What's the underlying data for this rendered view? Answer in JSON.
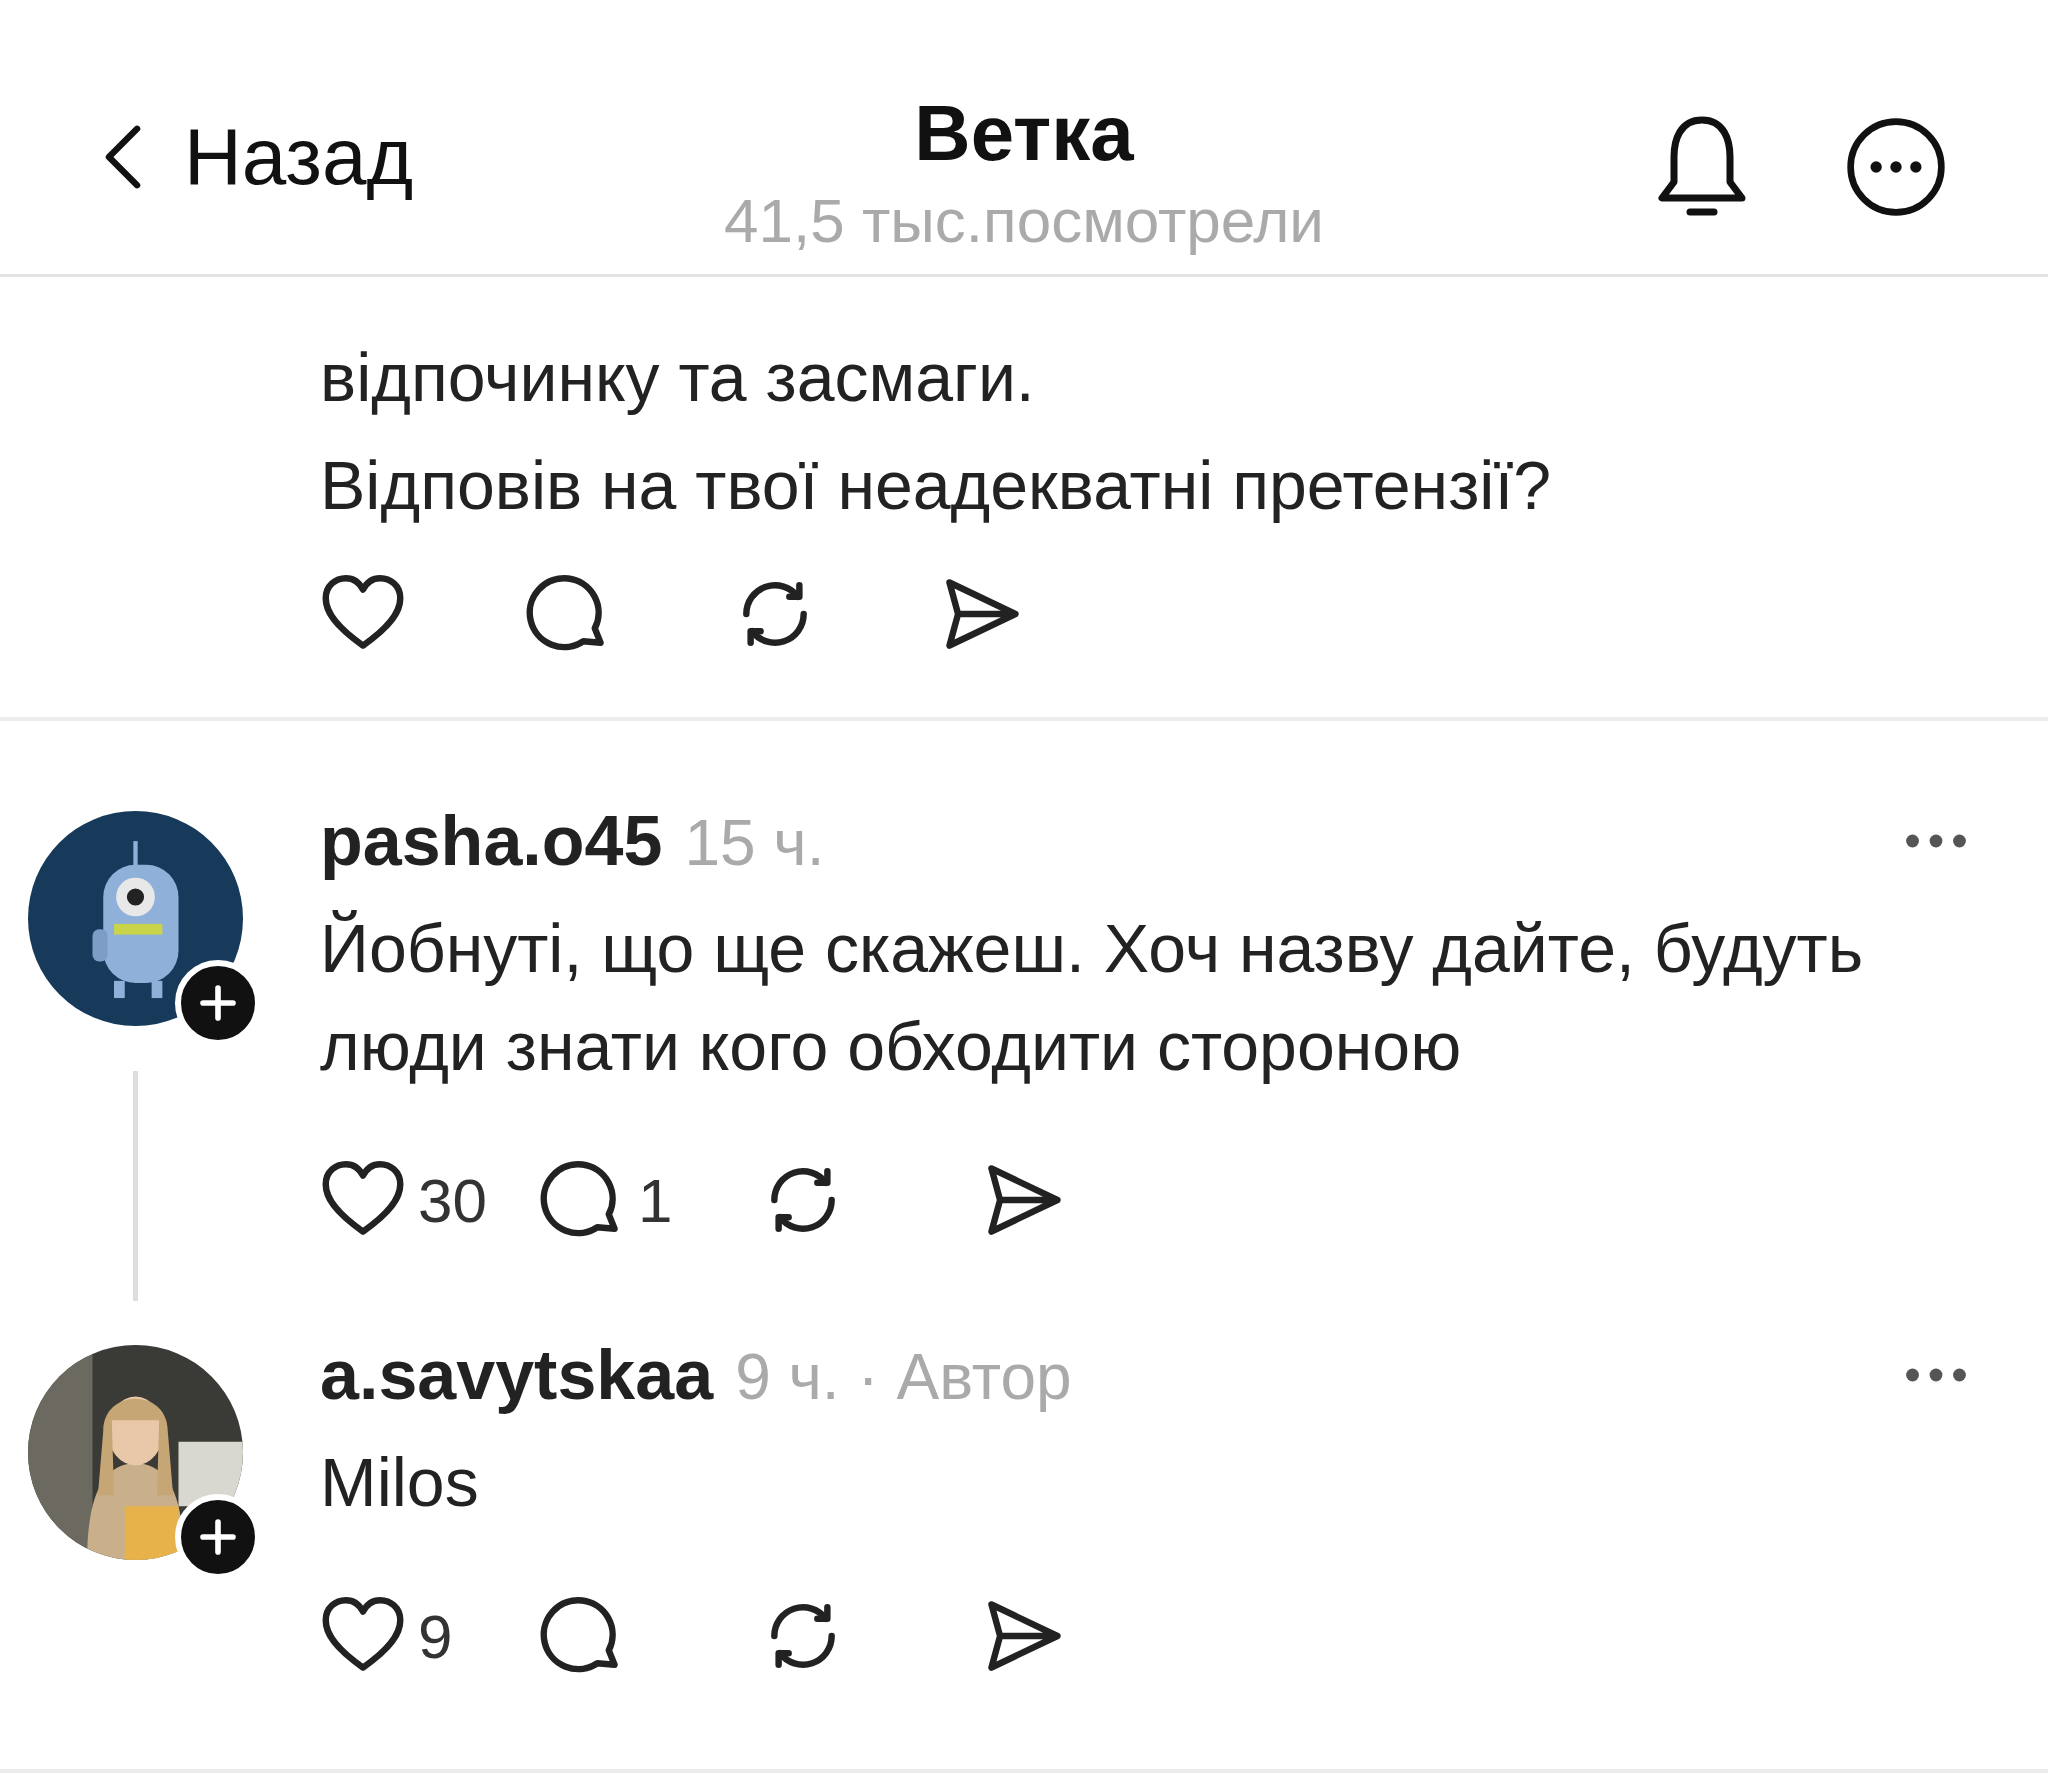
{
  "header": {
    "back_label": "Назад",
    "title": "Ветка",
    "subtitle": "41,5 тыс.посмотрели"
  },
  "parent_post": {
    "text_lines": [
      "відпочинку та засмаги.",
      "Відповів на твої неадекватні претензії?"
    ]
  },
  "replies": [
    {
      "username": "pasha.o45",
      "meta": "15 ч.",
      "text": "Йобнуті, що ще скажеш. Хоч назву дайте, будуть люди знати кого обходити стороною",
      "likes": "30",
      "comments": "1",
      "thread_line": true
    },
    {
      "username": "a.savytskaa",
      "meta": "9 ч. · Автор",
      "text": "Milos",
      "likes": "9",
      "thread_line": false
    }
  ]
}
